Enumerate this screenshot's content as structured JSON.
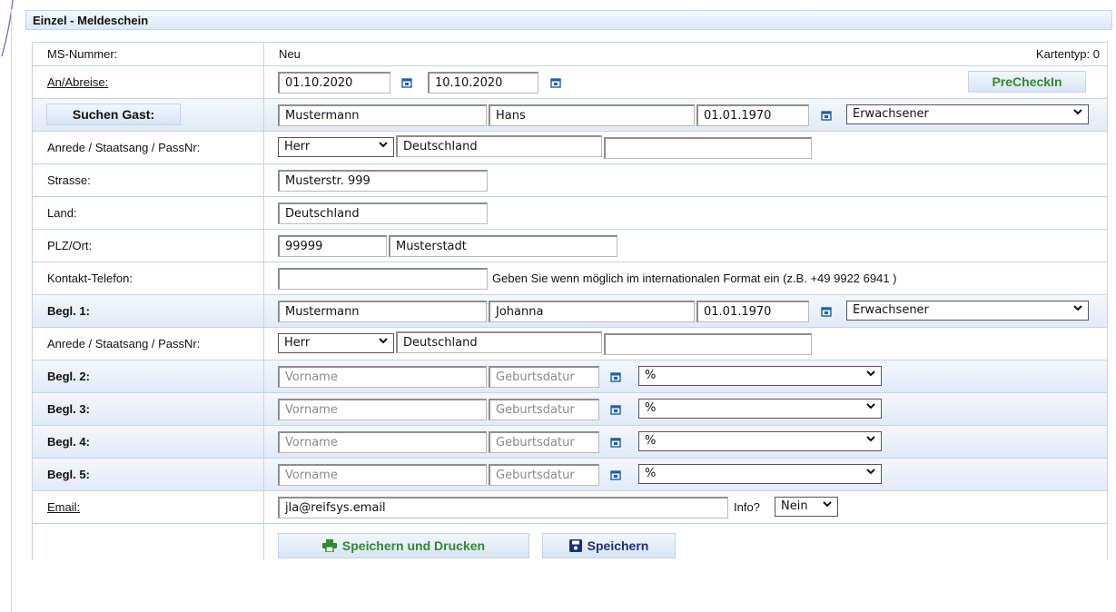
{
  "panel_title": "Einzel - Meldeschein",
  "ms": {
    "label": "MS-Nummer:",
    "value": "Neu",
    "kartentyp": "Kartentyp: 0"
  },
  "arrival": {
    "label": "An/Abreise:",
    "from": "01.10.2020",
    "to": "10.10.2020",
    "precheckin": "PreCheckIn"
  },
  "guest": {
    "search_label": "Suchen Gast:",
    "lastname": "Mustermann",
    "firstname": "Hans",
    "birthdate": "01.01.1970",
    "type": "Erwachsener"
  },
  "anrede1": {
    "label": "Anrede / Staatsang / PassNr:",
    "salutation": "Herr",
    "nationality": "Deutschland",
    "passport": ""
  },
  "street": {
    "label": "Strasse:",
    "value": "Musterstr. 999"
  },
  "country": {
    "label": "Land:",
    "value": "Deutschland"
  },
  "plz": {
    "label": "PLZ/Ort:",
    "zip": "99999",
    "city": "Musterstadt"
  },
  "phone": {
    "label": "Kontakt-Telefon:",
    "value": "",
    "hint": "Geben Sie wenn möglich im internationalen Format ein (z.B. +49 9922 6941 )"
  },
  "begl1": {
    "label": "Begl. 1:",
    "lastname": "Mustermann",
    "firstname": "Johanna",
    "birthdate": "01.01.1970",
    "type": "Erwachsener"
  },
  "anrede2": {
    "label": "Anrede / Staatsang / PassNr:",
    "salutation": "Herr",
    "nationality": "Deutschland",
    "passport": ""
  },
  "companions": [
    {
      "label": "Begl. 2:",
      "first_ph": "Vorname",
      "birth_ph": "Geburtsdatur",
      "type": "%"
    },
    {
      "label": "Begl. 3:",
      "first_ph": "Vorname",
      "birth_ph": "Geburtsdatur",
      "type": "%"
    },
    {
      "label": "Begl. 4:",
      "first_ph": "Vorname",
      "birth_ph": "Geburtsdatur",
      "type": "%"
    },
    {
      "label": "Begl. 5:",
      "first_ph": "Vorname",
      "birth_ph": "Geburtsdatur",
      "type": "%"
    }
  ],
  "email": {
    "label": "Email:",
    "value": "jla@reifsys.email",
    "info_label": "Info?",
    "info_value": "Nein"
  },
  "actions": {
    "save_print": "Speichern und Drucken",
    "save": "Speichern"
  },
  "colors": {
    "accent_green": "#2e8b2e",
    "accent_navy": "#1d2f7a",
    "border": "#c5d3e9"
  }
}
